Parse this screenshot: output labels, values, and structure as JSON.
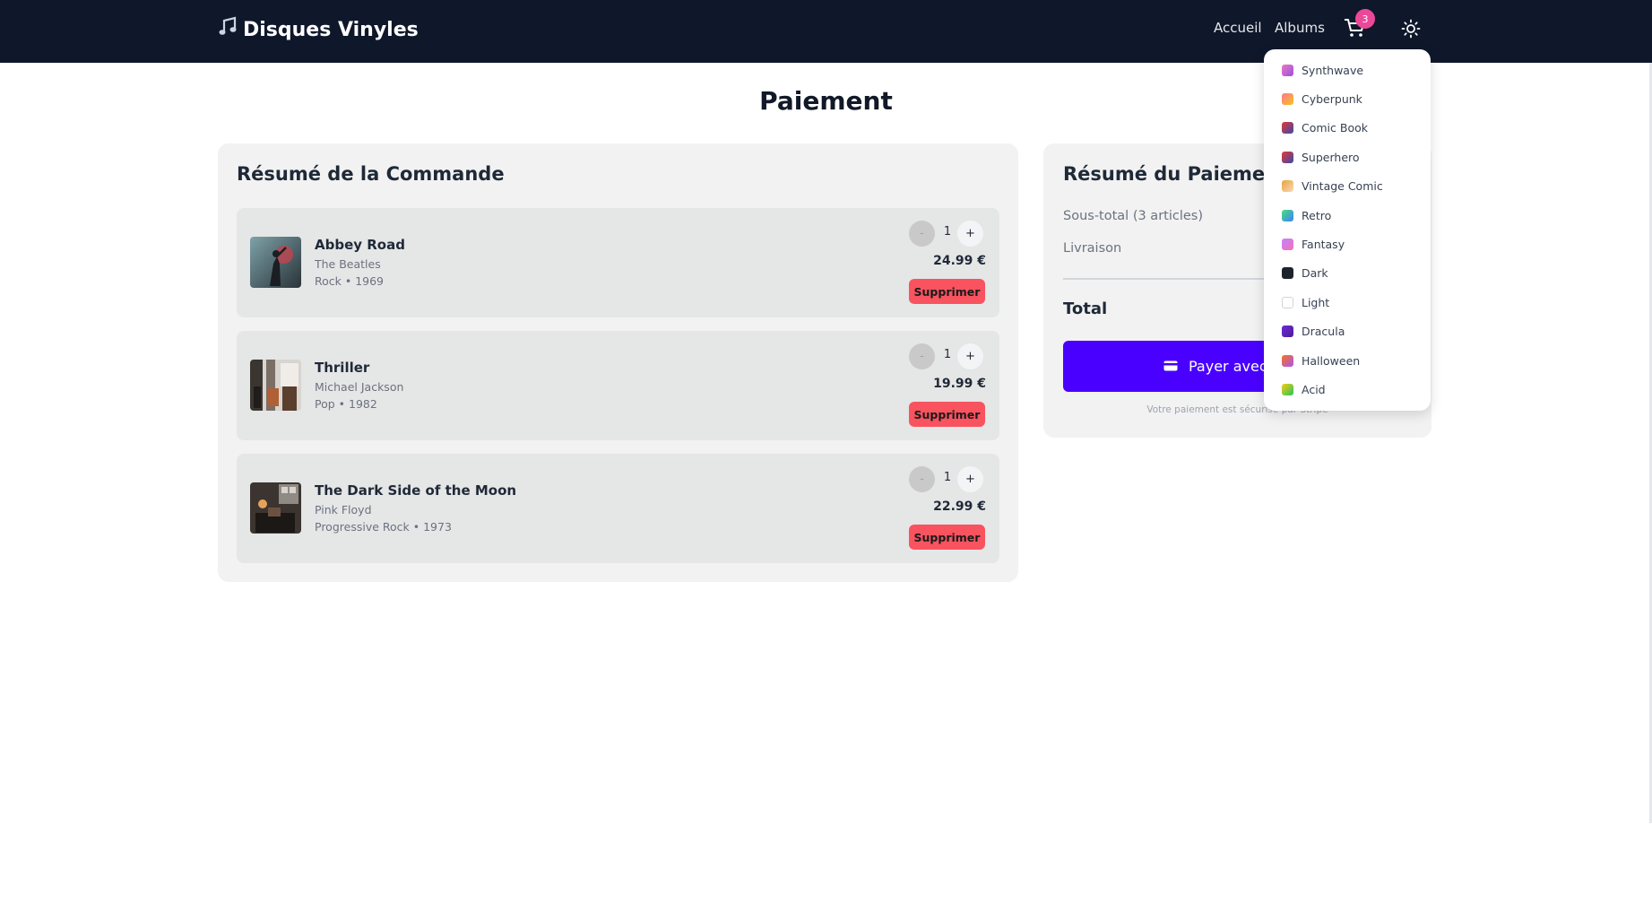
{
  "header": {
    "brand_icon": "music-note-icon",
    "brand_title": "Disques Vinyles",
    "nav": {
      "home": "Accueil",
      "albums": "Albums"
    },
    "cart_icon": "cart-icon",
    "cart_count": "3",
    "theme_icon": "sun-icon"
  },
  "page": {
    "title": "Paiement"
  },
  "order": {
    "title": "Résumé de la Commande",
    "items": [
      {
        "title": "Abbey Road",
        "artist": "The Beatles",
        "meta": "Rock • 1969",
        "qty": "1",
        "minus": "-",
        "plus": "+",
        "price": "24.99 €",
        "remove": "Supprimer"
      },
      {
        "title": "Thriller",
        "artist": "Michael Jackson",
        "meta": "Pop • 1982",
        "qty": "1",
        "minus": "-",
        "plus": "+",
        "price": "19.99 €",
        "remove": "Supprimer"
      },
      {
        "title": "The Dark Side of the Moon",
        "artist": "Pink Floyd",
        "meta": "Progressive Rock • 1973",
        "qty": "1",
        "minus": "-",
        "plus": "+",
        "price": "22.99 €",
        "remove": "Supprimer"
      }
    ]
  },
  "payment": {
    "title": "Résumé du Paiement",
    "subtotal_label": "Sous-total (3 articles)",
    "shipping_label": "Livraison",
    "total_label": "Total",
    "pay_button": "Payer avec",
    "pay_icon": "credit-card-icon",
    "secure_note": "Votre paiement est sécurisé par Stripe"
  },
  "theme_menu": {
    "items": [
      {
        "label": "Synthwave",
        "colors": [
          "#e779c1",
          "#9b51e0"
        ]
      },
      {
        "label": "Cyberpunk",
        "colors": [
          "#ff7598",
          "#f5c518"
        ]
      },
      {
        "label": "Comic Book",
        "colors": [
          "#e53935",
          "#3949ab"
        ]
      },
      {
        "label": "Superhero",
        "colors": [
          "#e53935",
          "#3949ab"
        ]
      },
      {
        "label": "Vintage Comic",
        "colors": [
          "#e8a43c",
          "#f7d9b8"
        ]
      },
      {
        "label": "Retro",
        "colors": [
          "#4ade80",
          "#3b82f6"
        ]
      },
      {
        "label": "Fantasy",
        "colors": [
          "#c084fc",
          "#f472b6"
        ]
      },
      {
        "label": "Dark",
        "colors": [
          "#1d232a",
          "#1d232a"
        ]
      },
      {
        "label": "Light",
        "colors": [
          "#ffffff",
          "#ffffff"
        ]
      },
      {
        "label": "Dracula",
        "colors": [
          "#6d28d9",
          "#4c1d95"
        ]
      },
      {
        "label": "Halloween",
        "colors": [
          "#f97316",
          "#a855f7"
        ]
      },
      {
        "label": "Acid",
        "colors": [
          "#facc15",
          "#22c55e"
        ]
      }
    ]
  },
  "colors": {
    "navbar": "#0f172a",
    "primary": "#4a00ff",
    "danger": "#f8535f",
    "badge": "#ec4899"
  }
}
